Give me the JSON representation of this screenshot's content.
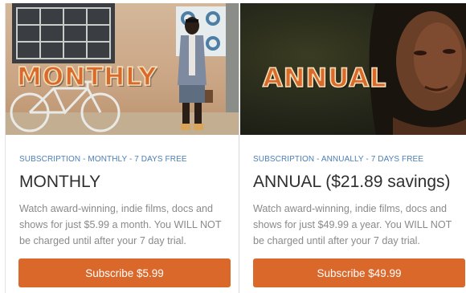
{
  "plans": {
    "monthly": {
      "hero_text": "MONTHLY",
      "tag": "SUBSCRIPTION - MONTHLY - 7 DAYS FREE",
      "title": "MONTHLY",
      "description": "Watch award-winning, indie films, docs and shows for just $5.99 a month. You WILL NOT be charged until after your 7 day trial.",
      "button_label": "Subscribe $5.99"
    },
    "annual": {
      "hero_text": "ANNUAL",
      "tag": "SUBSCRIPTION - ANNUALLY - 7 DAYS FREE",
      "title": "ANNUAL ($21.89 savings)",
      "description": "Watch award-winning, indie films, docs and shows for just $49.99 a year. You WILL NOT be charged until after your 7 day trial.",
      "button_label": "Subscribe $49.99"
    }
  },
  "colors": {
    "accent": "#d9682a",
    "tag": "#4b7fb4",
    "hero_title": "#d96a2c"
  }
}
